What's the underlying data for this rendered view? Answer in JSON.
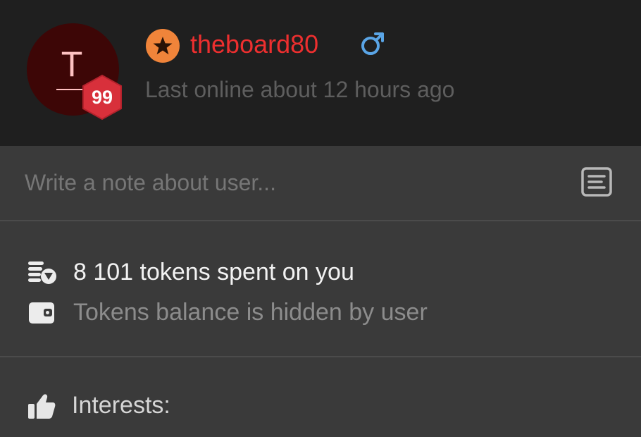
{
  "profile": {
    "avatar_letter": "T",
    "level": "99",
    "username": "theboard80",
    "last_online": "Last online about 12 hours ago",
    "rank_icon": "star-badge-icon",
    "gender_icon": "male-icon"
  },
  "note": {
    "placeholder": "Write a note about user...",
    "icon": "note-icon"
  },
  "stats": {
    "tokens_spent": "8 101 tokens spent on you",
    "balance": "Tokens balance is hidden by user"
  },
  "interests": {
    "label": "Interests:"
  },
  "colors": {
    "header_bg": "#1f1f1f",
    "body_bg": "#3a3a3a",
    "username": "#ed2f2f",
    "rank_badge": "#f0843a",
    "level_badge": "#d8303b",
    "gender": "#5aa5e6"
  }
}
